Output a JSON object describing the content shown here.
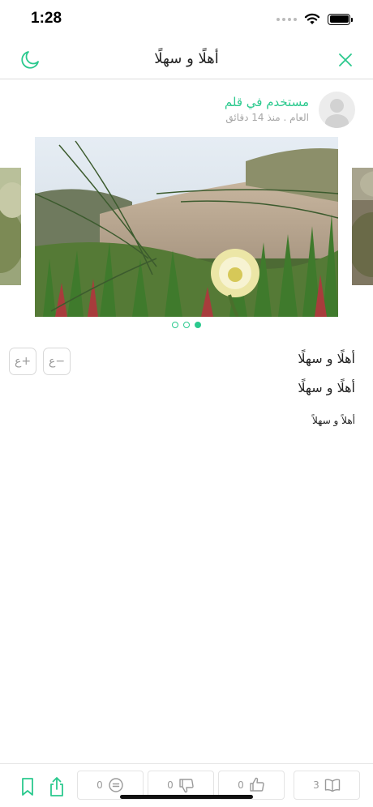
{
  "status_bar": {
    "time": "1:28"
  },
  "nav": {
    "title": "أهلًا و سهلًا"
  },
  "author": {
    "name": "مستخدم في قلم",
    "meta": "العام . منذ 14 دقائق"
  },
  "gallery": {
    "slide_count": 3,
    "active_index": 2
  },
  "font_controls": {
    "increase_label": "ع+",
    "decrease_label": "ع−"
  },
  "post": {
    "line1": "أهلًا و سهلًا",
    "line2": "أهلًا و سهلًا",
    "line3": "أهلاً و سهلاً"
  },
  "toolbar": {
    "comments_count": "0",
    "dislikes_count": "0",
    "likes_count": "0",
    "reads_count": "3"
  },
  "icons": [
    "moon-icon",
    "close-icon",
    "bookmark-icon",
    "share-icon",
    "comment-icon",
    "thumbs-down-icon",
    "thumbs-up-icon",
    "book-icon"
  ],
  "colors": {
    "accent": "#2bc98e",
    "meta_text": "#a6a6a6",
    "border": "#dcdcdc"
  }
}
